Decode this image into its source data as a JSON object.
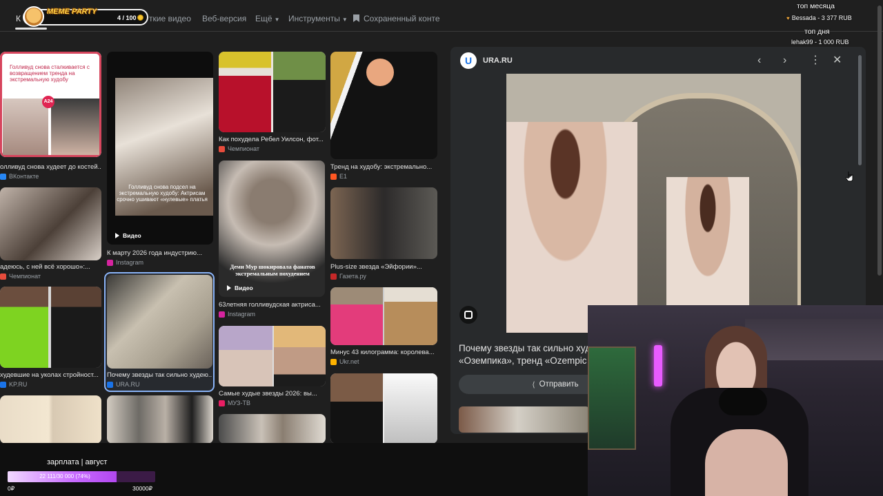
{
  "nav": {
    "first_tab": "К",
    "tabs": [
      "ткие видео",
      "Веб-версия",
      "Ещё",
      "Инструменты",
      "Сохраненный конте"
    ]
  },
  "meme_widget": {
    "title": "MEME PARTY",
    "count": "4 / 100",
    "progress": 0.04
  },
  "leaderboard": {
    "month_title": "топ месяца",
    "month_entry": "Bessada - 3 377 RUB",
    "day_title": "топ дня",
    "day_entry": "lehak99 - 1 000 RUB"
  },
  "grid": {
    "c1": [
      {
        "overlay": "Голливуд снова сталкивается с возвращением тренда на экстремальную худобу",
        "caption": "олливуд снова худеет до костей...",
        "source": "ВКонтакте",
        "fav_color": "#2787f5"
      },
      {
        "caption": "адеюсь, с ней всё хорошо»:...",
        "source": "Чемпионат",
        "fav_color": "#e74c3c"
      },
      {
        "caption": "худевшие на уколах стройност...",
        "source": "KP.RU",
        "fav_color": "#1a73e8"
      }
    ],
    "c2": [
      {
        "overlay": "Голливуд снова подсел на экстремальную худобу: Актрисам срочно ушивают «нулевые» платья",
        "video": "Видео",
        "caption": "К марту 2026 года индустрию...",
        "source": "Instagram",
        "fav_color": "#d6249f"
      },
      {
        "caption": "Почему звезды так сильно худею...",
        "source": "URA.RU",
        "fav_color": "#1a73e8"
      }
    ],
    "c3": [
      {
        "caption": "Как похудела Ребел Уилсон, фот...",
        "source": "Чемпионат",
        "fav_color": "#e74c3c"
      },
      {
        "overlay": "Деми Мур шокировала фанатов экстремальным похудением",
        "video": "Видео",
        "caption": "63летняя голливудская актриса...",
        "source": "Instagram",
        "fav_color": "#d6249f"
      },
      {
        "caption": "Самые худые звезды 2026: вы...",
        "source": "МУЗ-ТВ",
        "fav_color": "#e91e63"
      }
    ],
    "c4": [
      {
        "caption": "Тренд на худобу: экстремально...",
        "source": "E1",
        "fav_color": "#ff5722"
      },
      {
        "caption": "Plus-size звезда «Эйфории»...",
        "source": "Газета.ру",
        "fav_color": "#c62828"
      },
      {
        "caption": "Минус 43 килограмма: королева...",
        "source": "Ukr.net",
        "fav_color": "#ffb300"
      }
    ]
  },
  "panel": {
    "site": "URA.RU",
    "logo_letter": "U",
    "title_line1": "Почему звезды так сильно худ",
    "title_line2": "«Оземпика», тренд «Ozempic",
    "share_label": "Отправить"
  },
  "salary": {
    "label": "зарплата | август",
    "progress_text": "22 111/30 000 (74%)",
    "progress": 0.737,
    "min": "0₽",
    "max": "30000₽"
  }
}
